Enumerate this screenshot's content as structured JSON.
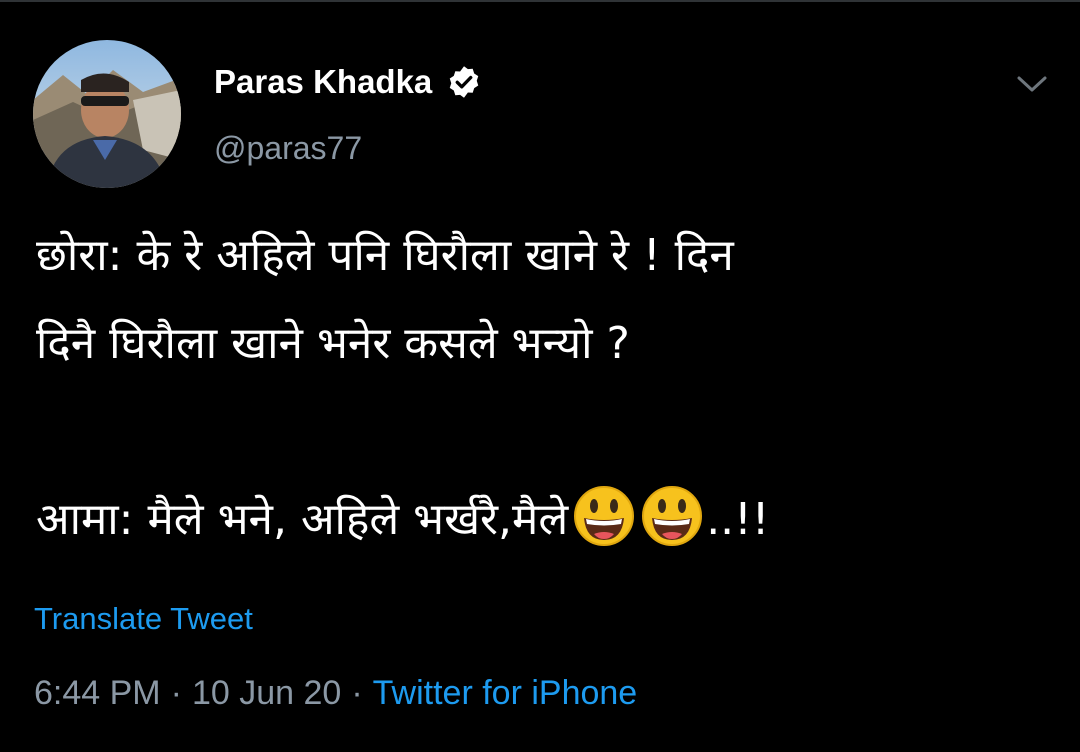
{
  "colors": {
    "background": "#000000",
    "primary_text": "#ffffff",
    "secondary_text": "#8b98a5",
    "link": "#1d9bf0"
  },
  "author": {
    "display_name": "Paras Khadka",
    "handle": "@paras77",
    "verified": true,
    "verified_icon": "verified-badge-icon",
    "avatar_icon": "avatar"
  },
  "menu": {
    "icon": "chevron-down-icon"
  },
  "tweet": {
    "lines": [
      "छोरा: के रे अहिले पनि घिरौला खाने रे ! दिन",
      "दिनै घिरौला खाने भनेर कसले भन्यो ?",
      "",
      "आमा: मैले भने, अहिले भर्खरै,मैले"
    ],
    "emoji": [
      "😃",
      "😃"
    ],
    "tail": "..!!"
  },
  "translate_label": "Translate Tweet",
  "meta": {
    "time": "6:44 PM",
    "separator": "·",
    "date": "10 Jun 20",
    "source": "Twitter for iPhone"
  }
}
